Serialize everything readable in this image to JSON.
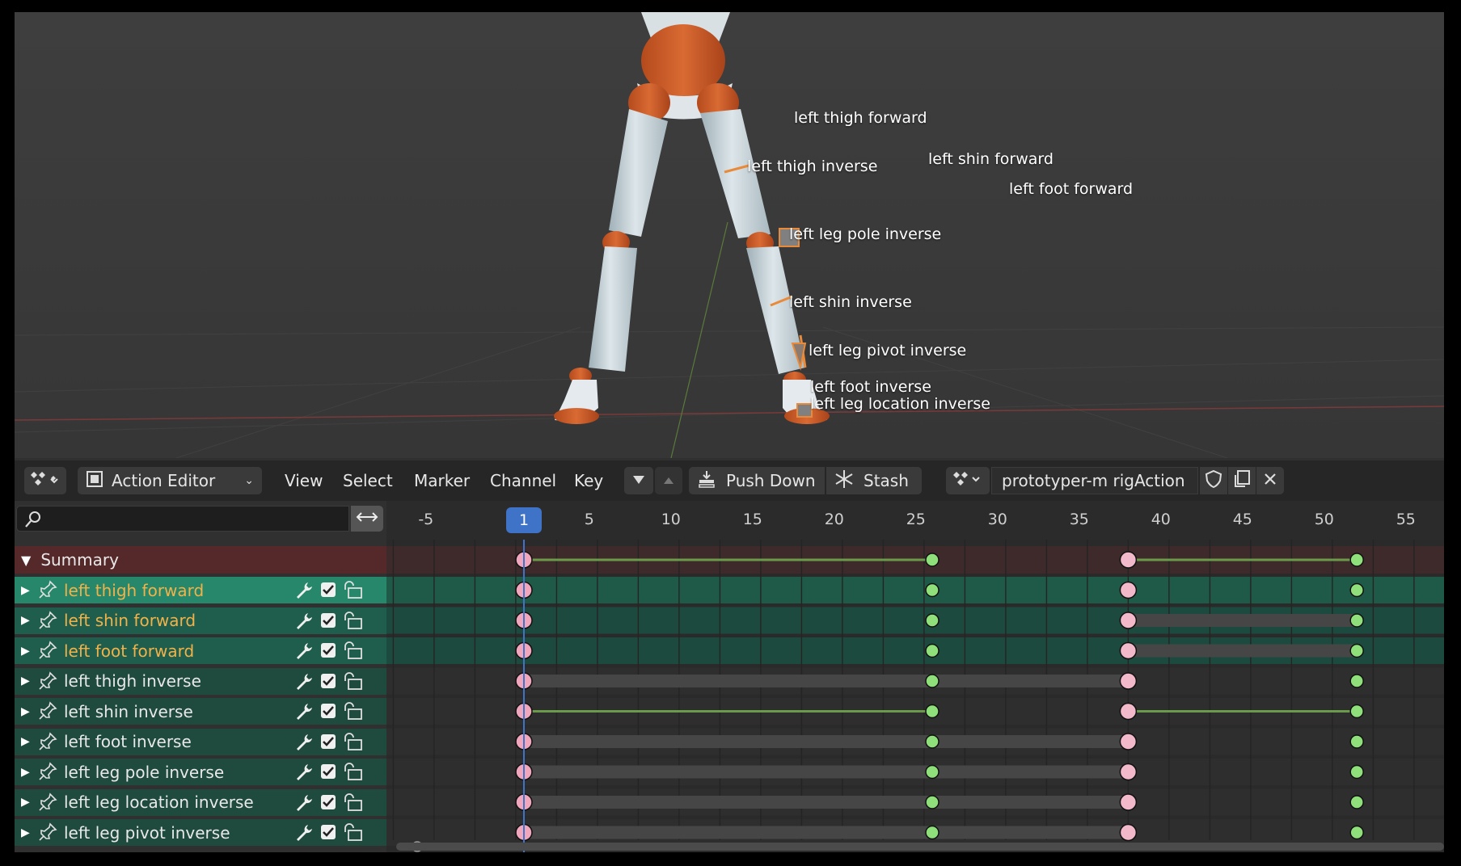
{
  "viewport": {
    "bone_labels": [
      "left thigh forward",
      "left shin forward",
      "left foot forward",
      "left thigh inverse",
      "left leg pole inverse",
      "left shin inverse",
      "left leg pivot inverse",
      "left foot inverse",
      "left leg location inverse"
    ]
  },
  "header": {
    "editor_mode": "Action Editor",
    "menus": [
      "View",
      "Select",
      "Marker",
      "Channel",
      "Key"
    ],
    "push_down_label": "Push Down",
    "stash_label": "Stash",
    "action_name": "prototyper-m rigAction"
  },
  "search": {
    "value": "",
    "placeholder": ""
  },
  "timeline": {
    "ruler_ticks": [
      "-5",
      "5",
      "10",
      "15",
      "20",
      "25",
      "30",
      "35",
      "40",
      "45",
      "50",
      "55"
    ],
    "current_frame": "1",
    "keyframe_frames": [
      1,
      26,
      38,
      52
    ]
  },
  "channels": {
    "summary_label": "Summary",
    "items": [
      {
        "label": "left thigh forward",
        "selected": true,
        "active": true,
        "holds": [
          "none",
          "none",
          "none"
        ]
      },
      {
        "label": "left shin forward",
        "selected": true,
        "active": false,
        "holds": [
          "none",
          "none",
          "bar"
        ]
      },
      {
        "label": "left foot forward",
        "selected": true,
        "active": false,
        "holds": [
          "none",
          "none",
          "bar"
        ]
      },
      {
        "label": "left thigh inverse",
        "selected": false,
        "active": false,
        "holds": [
          "bar",
          "bar",
          "none"
        ]
      },
      {
        "label": "left shin inverse",
        "selected": false,
        "active": false,
        "holds": [
          "line",
          "none",
          "line"
        ]
      },
      {
        "label": "left foot inverse",
        "selected": false,
        "active": false,
        "holds": [
          "bar",
          "bar",
          "none"
        ]
      },
      {
        "label": "left leg pole inverse",
        "selected": false,
        "active": false,
        "holds": [
          "bar",
          "bar",
          "none"
        ]
      },
      {
        "label": "left leg location inverse",
        "selected": false,
        "active": false,
        "holds": [
          "bar",
          "bar",
          "none"
        ]
      },
      {
        "label": "left leg pivot inverse",
        "selected": false,
        "active": false,
        "holds": [
          "bar",
          "bar",
          "none"
        ]
      }
    ],
    "summary_holds": [
      "line",
      "none",
      "line"
    ]
  },
  "colors": {
    "selected_row": "#1f5e4c",
    "active_row": "#26876a",
    "summary_row": "#55282a",
    "selected_text": "#f2b24a",
    "playhead": "#3f73c7",
    "key_first": "#f0a7bd",
    "key_green": "#8fe07a",
    "key_pink": "#f2b9cb",
    "hold_line": "#6b9a4a"
  },
  "icons": {
    "editor_type": "dopesheet-icon",
    "mode": "action-editor-icon",
    "filter_down": "triangle-down-icon",
    "filter_up": "triangle-up-icon",
    "push_down": "push-down-icon",
    "stash": "snowflake-icon",
    "action_type": "dopesheet-icon",
    "fake_user": "shield-icon",
    "new_action": "duplicate-icon",
    "unlink": "close-icon",
    "search": "search-icon",
    "swap": "swap-icon",
    "channel_pin": "pin-icon",
    "channel_modifier": "wrench-icon",
    "channel_check": "checkbox-icon",
    "channel_lock": "lock-icon"
  }
}
